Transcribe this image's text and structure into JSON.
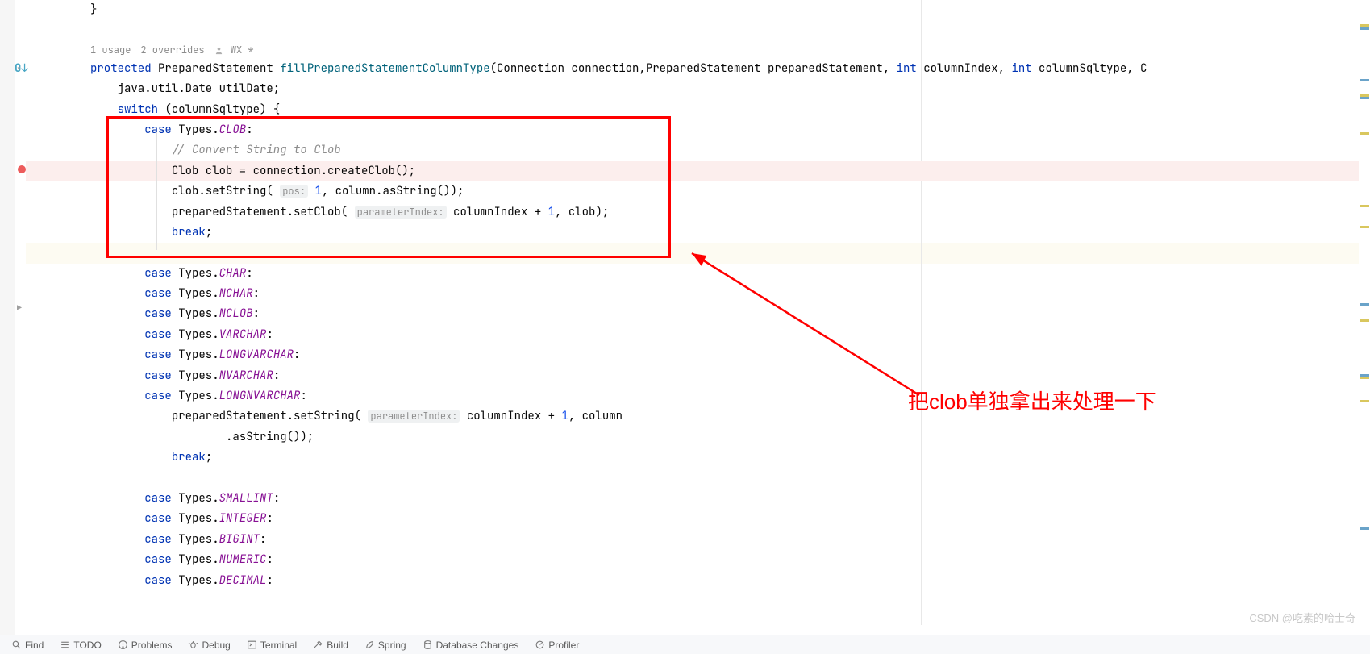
{
  "meta": {
    "usages": "1 usage",
    "overrides": "2 overrides",
    "author": "WX *"
  },
  "annotation": {
    "text": "把clob单独拿出来处理一下"
  },
  "watermark": "CSDN @吃素的哈士奇",
  "toolbar": {
    "find": "Find",
    "todo": "TODO",
    "problems": "Problems",
    "debug": "Debug",
    "terminal": "Terminal",
    "build": "Build",
    "spring": "Spring",
    "dbchanges": "Database Changes",
    "profiler": "Profiler"
  },
  "code": {
    "l0": "}",
    "l_sig_protected": "protected",
    "l_sig_type1": " PreparedStatement ",
    "l_sig_method": "fillPreparedStatementColumnType",
    "l_sig_p1": "(Connection connection,PreparedStatement preparedStatement, ",
    "l_sig_kw_int1": "int",
    "l_sig_p2": " columnIndex, ",
    "l_sig_kw_int2": "int",
    "l_sig_p3": " columnSqltype, C",
    "l_date": "    java.util.Date utilDate;",
    "l_switch_kw": "switch",
    "l_switch_rest": " (columnSqltype) {",
    "l_case": "case",
    "l_types": " Types.",
    "l_clob": "CLOB",
    "l_comment_clob": "// Convert String to Clob",
    "l_clob_decl": "Clob clob = connection.createClob();",
    "l_clob_set1a": "clob.setString( ",
    "l_hint_pos": "pos:",
    "l_clob_set1b": " ",
    "l_num_1": "1",
    "l_clob_set1c": ", column.asString());",
    "l_pstmt_setclob_a": "preparedStatement.setClob( ",
    "l_hint_pidx": "parameterIndex:",
    "l_pstmt_setclob_b": " columnIndex + ",
    "l_pstmt_setclob_c": ", clob);",
    "l_break": "break",
    "l_char": "CHAR",
    "l_nchar": "NCHAR",
    "l_nclob": "NCLOB",
    "l_varchar": "VARCHAR",
    "l_longvarchar": "LONGVARCHAR",
    "l_nvarchar": "NVARCHAR",
    "l_longnvarchar": "LONGNVARCHAR",
    "l_setstring_a": "preparedStatement.setString( ",
    "l_setstring_b": " columnIndex + ",
    "l_setstring_c": ", column",
    "l_asstring": "        .asString());",
    "l_smallint": "SMALLINT",
    "l_integer": "INTEGER",
    "l_bigint": "BIGINT",
    "l_numeric": "NUMERIC",
    "l_decimal": "DECIMAL"
  }
}
